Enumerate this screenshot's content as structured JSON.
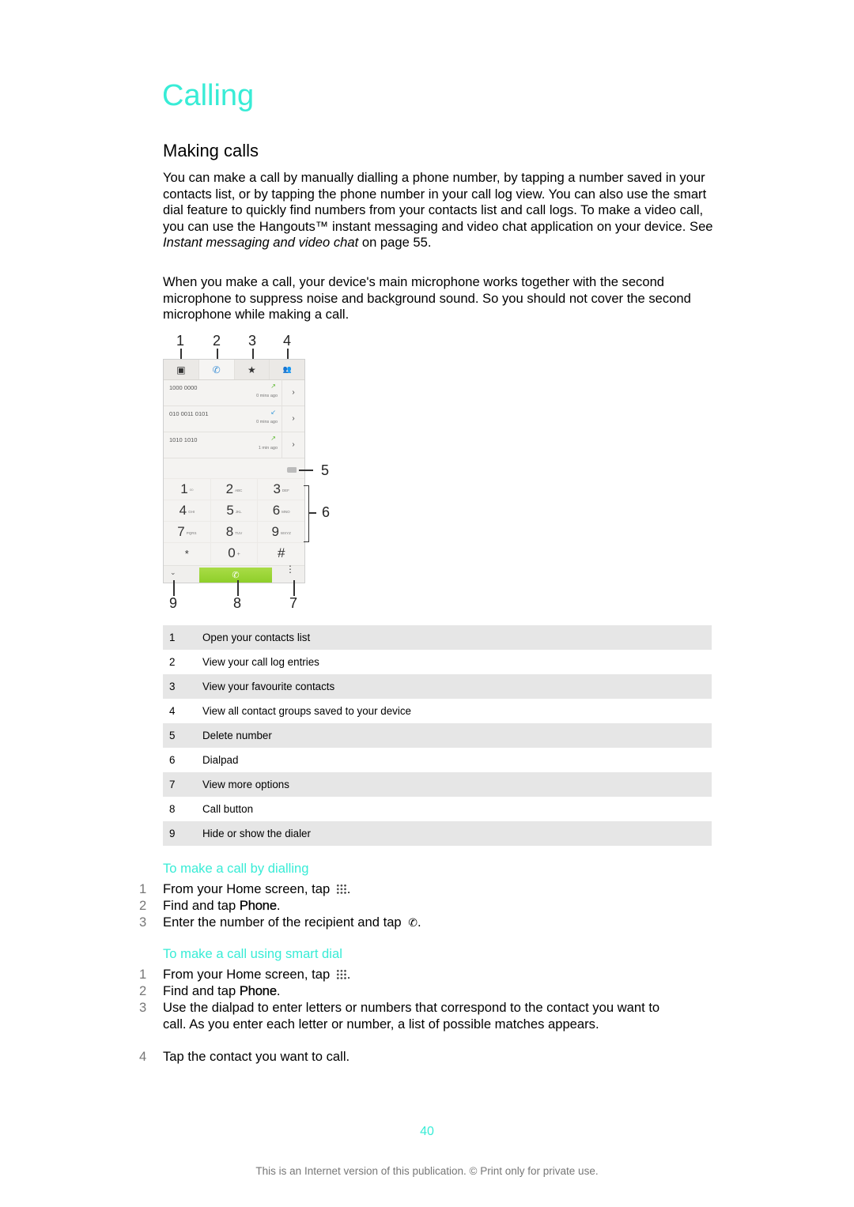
{
  "page": {
    "chapter_title": "Calling",
    "section_title": "Making calls",
    "paragraphs": {
      "p1_before_italic": "You can make a call by manually dialling a phone number, by tapping a number saved in your contacts list, or by tapping the phone number in your call log view. You can also use the smart dial feature to quickly find numbers from your contacts list and call logs. To make a video call, you can use the Hangouts™ instant messaging and video chat application on your device. See ",
      "p1_italic": "Instant messaging and video chat",
      "p1_after_italic": " on page 55.",
      "p2": "When you make a call, your device's main microphone works together with the second microphone to suppress noise and background sound. So you should not cover the second microphone while making a call."
    },
    "accent_color": "#38ecd6"
  },
  "figure": {
    "callouts": [
      "1",
      "2",
      "3",
      "4",
      "5",
      "6",
      "7",
      "8",
      "9"
    ],
    "tabs": [
      {
        "icon": "contacts-icon",
        "glyph": "▣"
      },
      {
        "icon": "call-log-icon",
        "glyph": "✆"
      },
      {
        "icon": "favourites-star-icon",
        "glyph": "★"
      },
      {
        "icon": "groups-icon",
        "glyph": "👥"
      }
    ],
    "call_log": [
      {
        "number": "1000 0000",
        "time": "0 mins ago",
        "direction": "outgoing",
        "arrow": "↗"
      },
      {
        "number": "010 0011 0101",
        "time": "0 mins ago",
        "direction": "incoming",
        "arrow": "↙"
      },
      {
        "number": "1010 1010",
        "time": "1 min ago",
        "direction": "outgoing",
        "arrow": "↗"
      }
    ],
    "dialpad": [
      [
        {
          "d": "1",
          "l": "ᴼᴼ"
        },
        {
          "d": "2",
          "l": "ABC"
        },
        {
          "d": "3",
          "l": "DEF"
        }
      ],
      [
        {
          "d": "4",
          "l": "GHI"
        },
        {
          "d": "5",
          "l": "JKL"
        },
        {
          "d": "6",
          "l": "MNO"
        }
      ],
      [
        {
          "d": "7",
          "l": "PQRS"
        },
        {
          "d": "8",
          "l": "TUV"
        },
        {
          "d": "9",
          "l": "WXYZ"
        }
      ],
      [
        {
          "d": "*",
          "l": ""
        },
        {
          "d": "0",
          "l": "+"
        },
        {
          "d": "#",
          "l": ""
        }
      ]
    ],
    "call_glyph": "✆",
    "hide_glyph": "⌄",
    "more_glyph": "⋮"
  },
  "legend": [
    {
      "n": "1",
      "text": "Open your contacts list"
    },
    {
      "n": "2",
      "text": "View your call log entries"
    },
    {
      "n": "3",
      "text": "View your favourite contacts"
    },
    {
      "n": "4",
      "text": "View all contact groups saved to your device"
    },
    {
      "n": "5",
      "text": "Delete number"
    },
    {
      "n": "6",
      "text": "Dialpad"
    },
    {
      "n": "7",
      "text": "View more options"
    },
    {
      "n": "8",
      "text": "Call button"
    },
    {
      "n": "9",
      "text": "Hide or show the dialer"
    }
  ],
  "procedures": [
    {
      "title": "To make a call by dialling",
      "steps": [
        {
          "n": "1",
          "text": "From your Home screen, tap ",
          "icon": "apps-grid-icon",
          "after": "."
        },
        {
          "n": "2",
          "text": "Find and tap ",
          "bold": "Phone",
          "after": "."
        },
        {
          "n": "3",
          "text": "Enter the number of the recipient and tap ",
          "icon": "phone-icon",
          "after": "."
        }
      ]
    },
    {
      "title": "To make a call using smart dial",
      "steps": [
        {
          "n": "1",
          "text": "From your Home screen, tap ",
          "icon": "apps-grid-icon",
          "after": "."
        },
        {
          "n": "2",
          "text": "Find and tap ",
          "bold": "Phone",
          "after": "."
        },
        {
          "n": "3",
          "text": "Use the dialpad to enter letters or numbers that correspond to the contact you want to call. As you enter each letter or number, a list of possible matches appears."
        },
        {
          "n": "4",
          "text": "Tap the contact you want to call."
        }
      ]
    }
  ],
  "footer": {
    "page_number": "40",
    "notice": "This is an Internet version of this publication. © Print only for private use."
  }
}
